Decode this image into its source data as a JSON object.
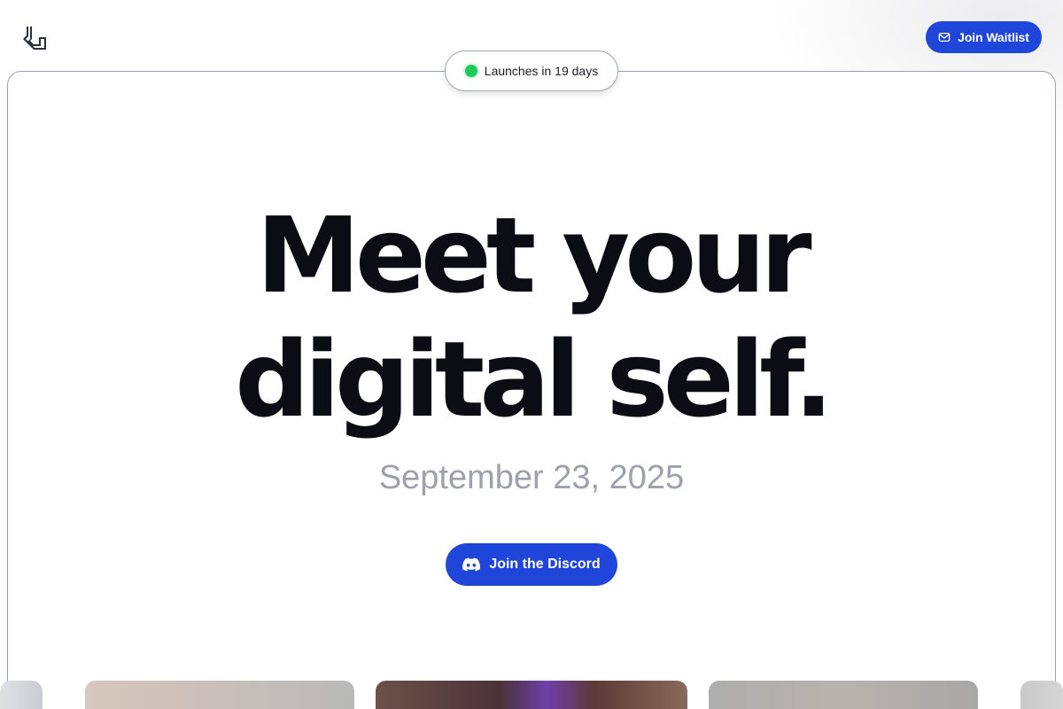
{
  "header": {
    "logo_icon": "bracket-arrow-logo-icon",
    "waitlist_button": {
      "label": "Join Waitlist",
      "icon": "envelope-icon"
    }
  },
  "launch_badge": {
    "text": "Launches in 19 days",
    "status_color": "#1ecb57"
  },
  "hero": {
    "headline_line1": "Meet your",
    "headline_line2": "digital self.",
    "date": "September 23, 2025",
    "discord_button": {
      "label": "Join the Discord",
      "icon": "discord-icon"
    }
  },
  "colors": {
    "accent": "#1f45d9",
    "headline": "#0c0c14",
    "date_text": "#9ca1ac"
  },
  "gallery": {
    "thumbnails": [
      "image-thumbnail",
      "image-thumbnail",
      "image-thumbnail",
      "image-thumbnail",
      "image-thumbnail"
    ]
  }
}
